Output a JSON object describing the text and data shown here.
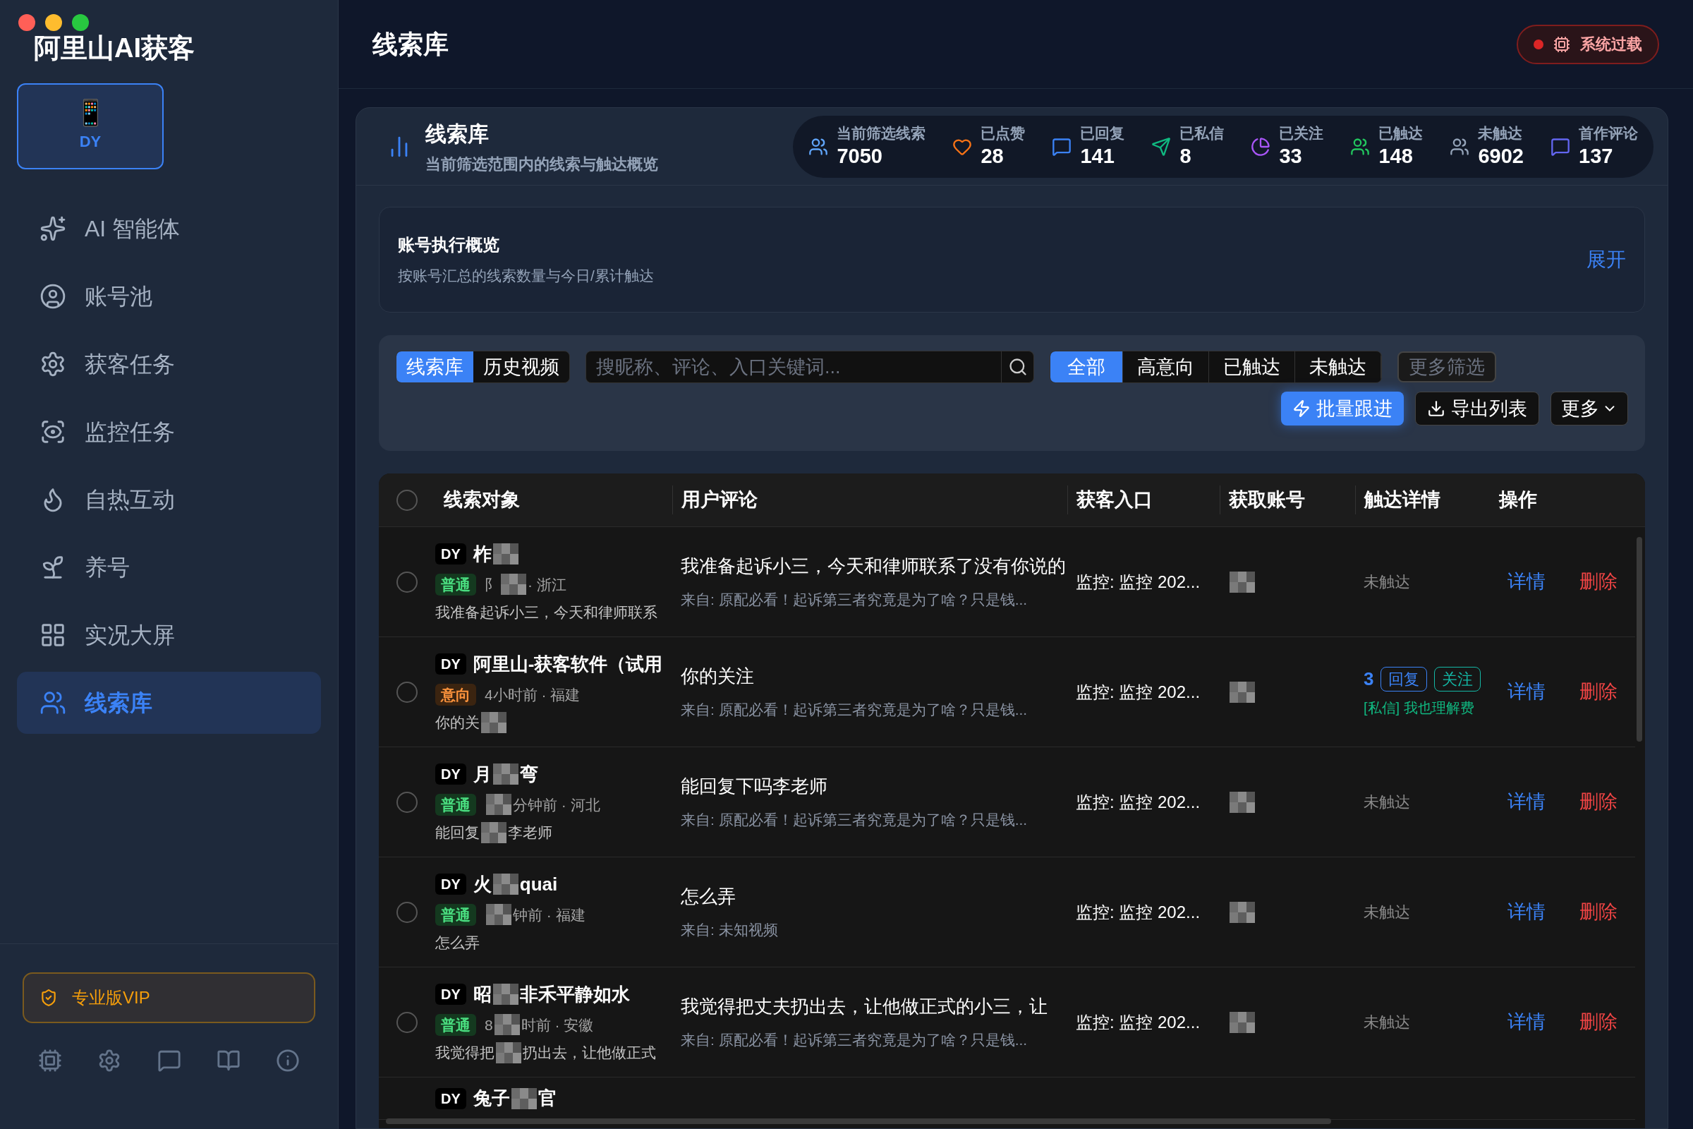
{
  "app": {
    "title": "阿里山AI获客",
    "platform": {
      "label": "DY",
      "emoji": "📱",
      "selected": true
    }
  },
  "sidebar": {
    "items": [
      {
        "label": "AI 智能体",
        "selected": false
      },
      {
        "label": "账号池",
        "selected": false
      },
      {
        "label": "获客任务",
        "selected": false
      },
      {
        "label": "监控任务",
        "selected": false
      },
      {
        "label": "自热互动",
        "selected": false
      },
      {
        "label": "养号",
        "selected": false
      },
      {
        "label": "实况大屏",
        "selected": false
      },
      {
        "label": "线索库",
        "selected": true
      }
    ],
    "vip": "专业版VIP"
  },
  "header": {
    "title": "线索库",
    "status": "系统过载"
  },
  "summary": {
    "title": "线索库",
    "subtitle": "当前筛选范围内的线索与触达概览",
    "stats": [
      {
        "label": "当前筛选线索",
        "value": "7050",
        "color": "#60a5fa"
      },
      {
        "label": "已点赞",
        "value": "28",
        "color": "#f97316"
      },
      {
        "label": "已回复",
        "value": "141",
        "color": "#3b82f6"
      },
      {
        "label": "已私信",
        "value": "8",
        "color": "#10b981"
      },
      {
        "label": "已关注",
        "value": "33",
        "color": "#a855f7"
      },
      {
        "label": "已触达",
        "value": "148",
        "color": "#22c55e"
      },
      {
        "label": "未触达",
        "value": "6902",
        "color": "#94a3b8"
      },
      {
        "label": "首作评论",
        "value": "137",
        "color": "#6366f1"
      }
    ]
  },
  "account_overview": {
    "title": "账号执行概览",
    "subtitle": "按账号汇总的线索数量与今日/累计触达",
    "toggle": "展开"
  },
  "filters": {
    "sources": [
      {
        "label": "线索库",
        "selected": true
      },
      {
        "label": "历史视频",
        "selected": false
      }
    ],
    "search": {
      "placeholder": "搜昵称、评论、入口关键词..."
    },
    "segments": [
      {
        "label": "全部",
        "selected": true
      },
      {
        "label": "高意向",
        "selected": false
      },
      {
        "label": "已触达",
        "selected": false
      },
      {
        "label": "未触达",
        "selected": false
      }
    ],
    "more_filters": "更多筛选",
    "actions": [
      {
        "label": "批量跟进",
        "kind": "primary"
      },
      {
        "label": "导出列表",
        "kind": "export"
      },
      {
        "label": "更多",
        "kind": "menu"
      }
    ]
  },
  "table": {
    "select_all": {
      "checked": false
    },
    "columns": [
      "线索对象",
      "用户评论",
      "获客入口",
      "获取账号",
      "触达详情",
      "操作"
    ],
    "rows": [
      {
        "checked": false,
        "platform": "DY",
        "name": [
          {
            "kind": "text",
            "text": "柞"
          },
          {
            "kind": "redacted"
          }
        ],
        "tag": {
          "text": "普通",
          "kind": "normal"
        },
        "meta": [
          {
            "kind": "text",
            "text": "阝"
          },
          {
            "kind": "redacted"
          },
          {
            "kind": "text",
            "text": "· 浙江"
          }
        ],
        "preview": [
          {
            "kind": "text",
            "text": "我准备起诉小三，今天和律师联系"
          }
        ],
        "comment": "我准备起诉小三，今天和律师联系了没有你说的",
        "source": "来自: 原配必看！起诉第三者究竟是为了啥？只是钱...",
        "entry": "监控: 监控 202...",
        "reach": {
          "kind": "none",
          "text": "未触达"
        },
        "actions": [
          "详情",
          "删除"
        ]
      },
      {
        "checked": false,
        "platform": "DY",
        "name": [
          {
            "kind": "text",
            "text": "阿里山-获客软件（试用"
          }
        ],
        "tag": {
          "text": "意向",
          "kind": "intent"
        },
        "meta": [
          {
            "kind": "text",
            "text": "4小时前 · 福建"
          }
        ],
        "preview": [
          {
            "kind": "text",
            "text": "你的关"
          },
          {
            "kind": "redacted"
          }
        ],
        "comment": "你的关注",
        "source": "来自: 原配必看！起诉第三者究竟是为了啥？只是钱...",
        "entry": "监控: 监控 202...",
        "reach": {
          "kind": "reached",
          "count": "3",
          "tags": [
            {
              "text": "回复",
              "color": "#3b82f6"
            },
            {
              "text": "关注",
              "color": "#14b8a6"
            }
          ],
          "message": "[私信] 我也理解费"
        },
        "actions": [
          "详情",
          "删除"
        ]
      },
      {
        "checked": false,
        "platform": "DY",
        "name": [
          {
            "kind": "text",
            "text": "月"
          },
          {
            "kind": "redacted"
          },
          {
            "kind": "text",
            "text": "弯"
          }
        ],
        "tag": {
          "text": "普通",
          "kind": "normal"
        },
        "meta": [
          {
            "kind": "redacted"
          },
          {
            "kind": "text",
            "text": "分钟前 · 河北"
          }
        ],
        "preview": [
          {
            "kind": "text",
            "text": "能回复"
          },
          {
            "kind": "redacted"
          },
          {
            "kind": "text",
            "text": "李老师"
          }
        ],
        "comment": "能回复下吗李老师",
        "source": "来自: 原配必看！起诉第三者究竟是为了啥？只是钱...",
        "entry": "监控: 监控 202...",
        "reach": {
          "kind": "none",
          "text": "未触达"
        },
        "actions": [
          "详情",
          "删除"
        ]
      },
      {
        "checked": false,
        "platform": "DY",
        "name": [
          {
            "kind": "text",
            "text": "火"
          },
          {
            "kind": "redacted"
          },
          {
            "kind": "text",
            "text": "quai"
          }
        ],
        "tag": {
          "text": "普通",
          "kind": "normal"
        },
        "meta": [
          {
            "kind": "redacted"
          },
          {
            "kind": "text",
            "text": "钟前 · 福建"
          }
        ],
        "preview": [
          {
            "kind": "text",
            "text": "怎么弄"
          }
        ],
        "comment": "怎么弄",
        "source": "来自: 未知视频",
        "entry": "监控: 监控 202...",
        "reach": {
          "kind": "none",
          "text": "未触达"
        },
        "actions": [
          "详情",
          "删除"
        ]
      },
      {
        "checked": false,
        "platform": "DY",
        "name": [
          {
            "kind": "text",
            "text": "昭"
          },
          {
            "kind": "redacted"
          },
          {
            "kind": "text",
            "text": "非禾平静如水"
          }
        ],
        "tag": {
          "text": "普通",
          "kind": "normal"
        },
        "meta": [
          {
            "kind": "text",
            "text": "8"
          },
          {
            "kind": "redacted"
          },
          {
            "kind": "text",
            "text": "时前 · 安徽"
          }
        ],
        "preview": [
          {
            "kind": "text",
            "text": "我觉得把"
          },
          {
            "kind": "redacted"
          },
          {
            "kind": "text",
            "text": "扔出去，让他做正式"
          }
        ],
        "comment": "我觉得把丈夫扔出去，让他做正式的小三，让",
        "source": "来自: 原配必看！起诉第三者究竟是为了啥？只是钱...",
        "entry": "监控: 监控 202...",
        "reach": {
          "kind": "none",
          "text": "未触达"
        },
        "actions": [
          "详情",
          "删除"
        ]
      },
      {
        "platform": "DY",
        "name": [
          {
            "kind": "text",
            "text": "兔子"
          },
          {
            "kind": "redacted"
          },
          {
            "kind": "text",
            "text": "官"
          }
        ]
      }
    ]
  }
}
